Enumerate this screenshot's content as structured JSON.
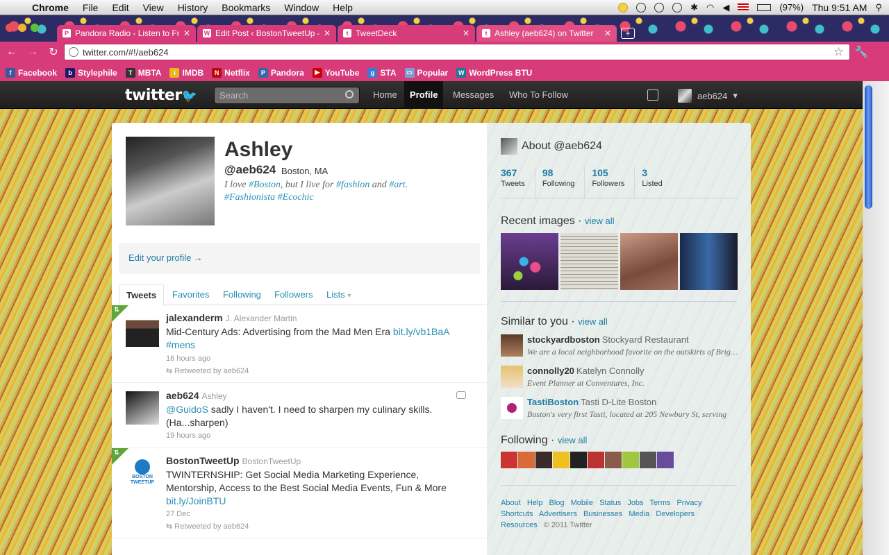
{
  "menubar": {
    "app": "Chrome",
    "items": [
      "File",
      "Edit",
      "View",
      "History",
      "Bookmarks",
      "Window",
      "Help"
    ],
    "battery": "(97%)",
    "clock": "Thu 9:51 AM"
  },
  "browser": {
    "tabs": [
      {
        "label": "Pandora Radio - Listen to Fr",
        "icon": "P"
      },
      {
        "label": "Edit Post ‹ BostonTweetUp —",
        "icon": "W"
      },
      {
        "label": "TweetDeck",
        "icon": "t"
      },
      {
        "label": "Ashley (aeb624) on Twitter",
        "icon": "t"
      }
    ],
    "new_tab": "+",
    "url": "twitter.com/#!/aeb624",
    "bookmarks": [
      {
        "label": "Facebook",
        "icon": "f",
        "color": "#3b5998"
      },
      {
        "label": "Stylephile",
        "icon": "b",
        "color": "#1a1a6a"
      },
      {
        "label": "MBTA",
        "icon": "T",
        "color": "#333"
      },
      {
        "label": "IMDB",
        "icon": "i",
        "color": "#e6b91e"
      },
      {
        "label": "Netflix",
        "icon": "N",
        "color": "#b9090b"
      },
      {
        "label": "Pandora",
        "icon": "P",
        "color": "#3668a8"
      },
      {
        "label": "YouTube",
        "icon": "▶",
        "color": "#cc0000"
      },
      {
        "label": "STA",
        "icon": "g",
        "color": "#3a7bd5"
      },
      {
        "label": "Popular",
        "icon": "▭",
        "color": "#7aa0d4"
      },
      {
        "label": "WordPress BTU",
        "icon": "W",
        "color": "#21759b"
      }
    ]
  },
  "twitter": {
    "logo": "twitter",
    "search_placeholder": "Search",
    "nav": [
      "Home",
      "Profile",
      "Messages",
      "Who To Follow"
    ],
    "username_menu": "aeb624"
  },
  "profile": {
    "name": "Ashley",
    "handle": "@aeb624",
    "location": "Boston, MA",
    "bio_parts": [
      "I love ",
      "#Boston",
      ", but I live for ",
      "#fashion",
      " and ",
      "#art",
      ". ",
      "#Fashionista",
      " ",
      "#Ecochic"
    ],
    "edit_link": "Edit your profile →",
    "tabs": [
      "Tweets",
      "Favorites",
      "Following",
      "Followers",
      "Lists"
    ]
  },
  "tweets": [
    {
      "user": "jalexanderm",
      "fullname": "J. Alexander Martin",
      "text": "Mid-Century Ads: Advertising from the Mad Men Era ",
      "link": "bit.ly/vb1BaA",
      "tag": "#mens",
      "time": "16 hours ago",
      "retweet": "Retweeted by aeb624"
    },
    {
      "user": "aeb624",
      "fullname": "Ashley",
      "mention": "@GuidoS",
      "text": " sadly I haven't. I need to sharpen my culinary skills. (Ha...sharpen)",
      "time": "19 hours ago"
    },
    {
      "user": "BostonTweetUp",
      "fullname": "BostonTweetUp",
      "text": "TWINTERNSHIP: Get Social Media Marketing Experience, Mentorship, Access to the Best Social Media Events, Fun & More ",
      "link": "bit.ly/JoinBTU",
      "time": "27 Dec",
      "retweet": "Retweeted by aeb624"
    }
  ],
  "sidebar": {
    "about": "About @aeb624",
    "stats": [
      {
        "n": "367",
        "l": "Tweets"
      },
      {
        "n": "98",
        "l": "Following"
      },
      {
        "n": "105",
        "l": "Followers"
      },
      {
        "n": "3",
        "l": "Listed"
      }
    ],
    "recent_images": "Recent images",
    "similar": "Similar to you",
    "following": "Following",
    "view_all": "view all",
    "similar_users": [
      {
        "user": "stockyardboston",
        "name": "Stockyard Restaurant",
        "desc": "We are a local neighborhood favorite on the outskirts of Brighton"
      },
      {
        "user": "connolly20",
        "name": "Katelyn Connolly",
        "desc": "Event Planner at Conventures, Inc."
      },
      {
        "user": "TastiBoston",
        "name": "Tasti D-Lite Boston",
        "desc": "Boston's very first Tasti, located at 205 Newbury St, serving"
      }
    ],
    "footer_links": [
      "About",
      "Help",
      "Blog",
      "Mobile",
      "Status",
      "Jobs",
      "Terms",
      "Privacy",
      "Shortcuts",
      "Advertisers",
      "Businesses",
      "Media",
      "Developers",
      "Resources"
    ],
    "copyright": "© 2011 Twitter"
  }
}
